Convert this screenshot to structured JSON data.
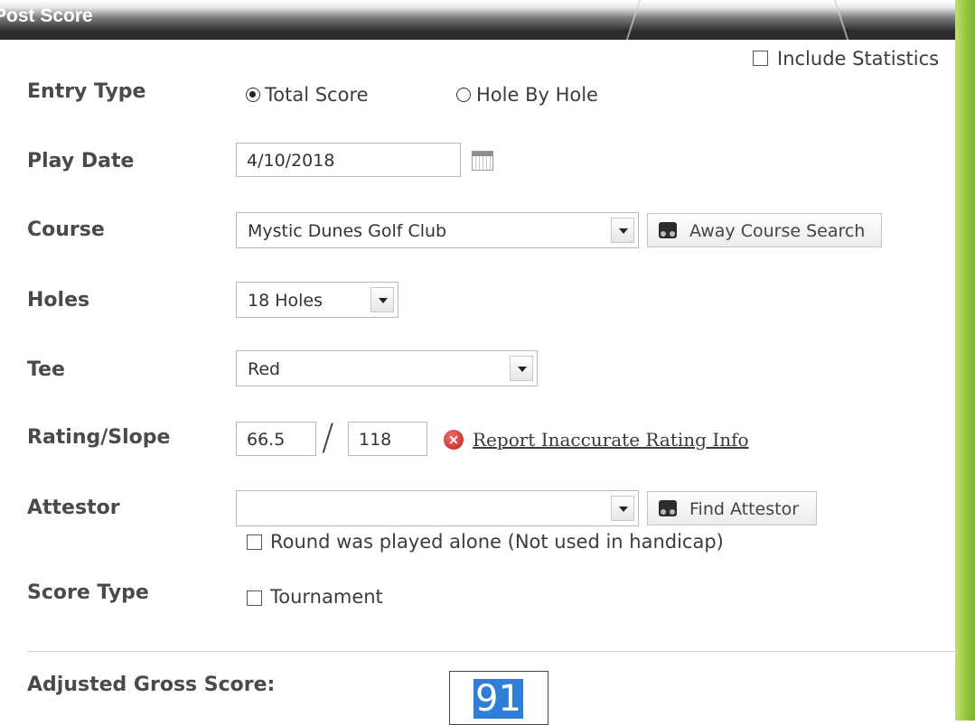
{
  "panel": {
    "title": "Post Score"
  },
  "include_statistics": {
    "label": "Include Statistics",
    "checked": false
  },
  "entry_type": {
    "label": "Entry Type",
    "options": [
      {
        "label": "Total Score",
        "selected": true
      },
      {
        "label": "Hole By Hole",
        "selected": false
      }
    ]
  },
  "play_date": {
    "label": "Play Date",
    "value": "4/10/2018"
  },
  "course": {
    "label": "Course",
    "value": "Mystic Dunes Golf Club",
    "search_button": "Away Course Search"
  },
  "holes": {
    "label": "Holes",
    "value": "18 Holes"
  },
  "tee": {
    "label": "Tee",
    "value": "Red"
  },
  "rating_slope": {
    "label": "Rating/Slope",
    "rating": "66.5",
    "separator": "/",
    "slope": "118",
    "report_link": "Report Inaccurate Rating Info"
  },
  "attestor": {
    "label": "Attestor",
    "value": "",
    "find_button": "Find Attestor",
    "played_alone_label": "Round was played alone (Not used in handicap)",
    "played_alone_checked": false
  },
  "score_type": {
    "label": "Score Type",
    "tournament_label": "Tournament",
    "tournament_checked": false
  },
  "adjusted_gross": {
    "label": "Adjusted Gross Score:",
    "value": "91"
  },
  "colors": {
    "accent_green": "#8fc23a",
    "title_bar": "#2a2a2a",
    "selection_blue": "#2f7fd8",
    "error_red": "#c41a1a"
  }
}
